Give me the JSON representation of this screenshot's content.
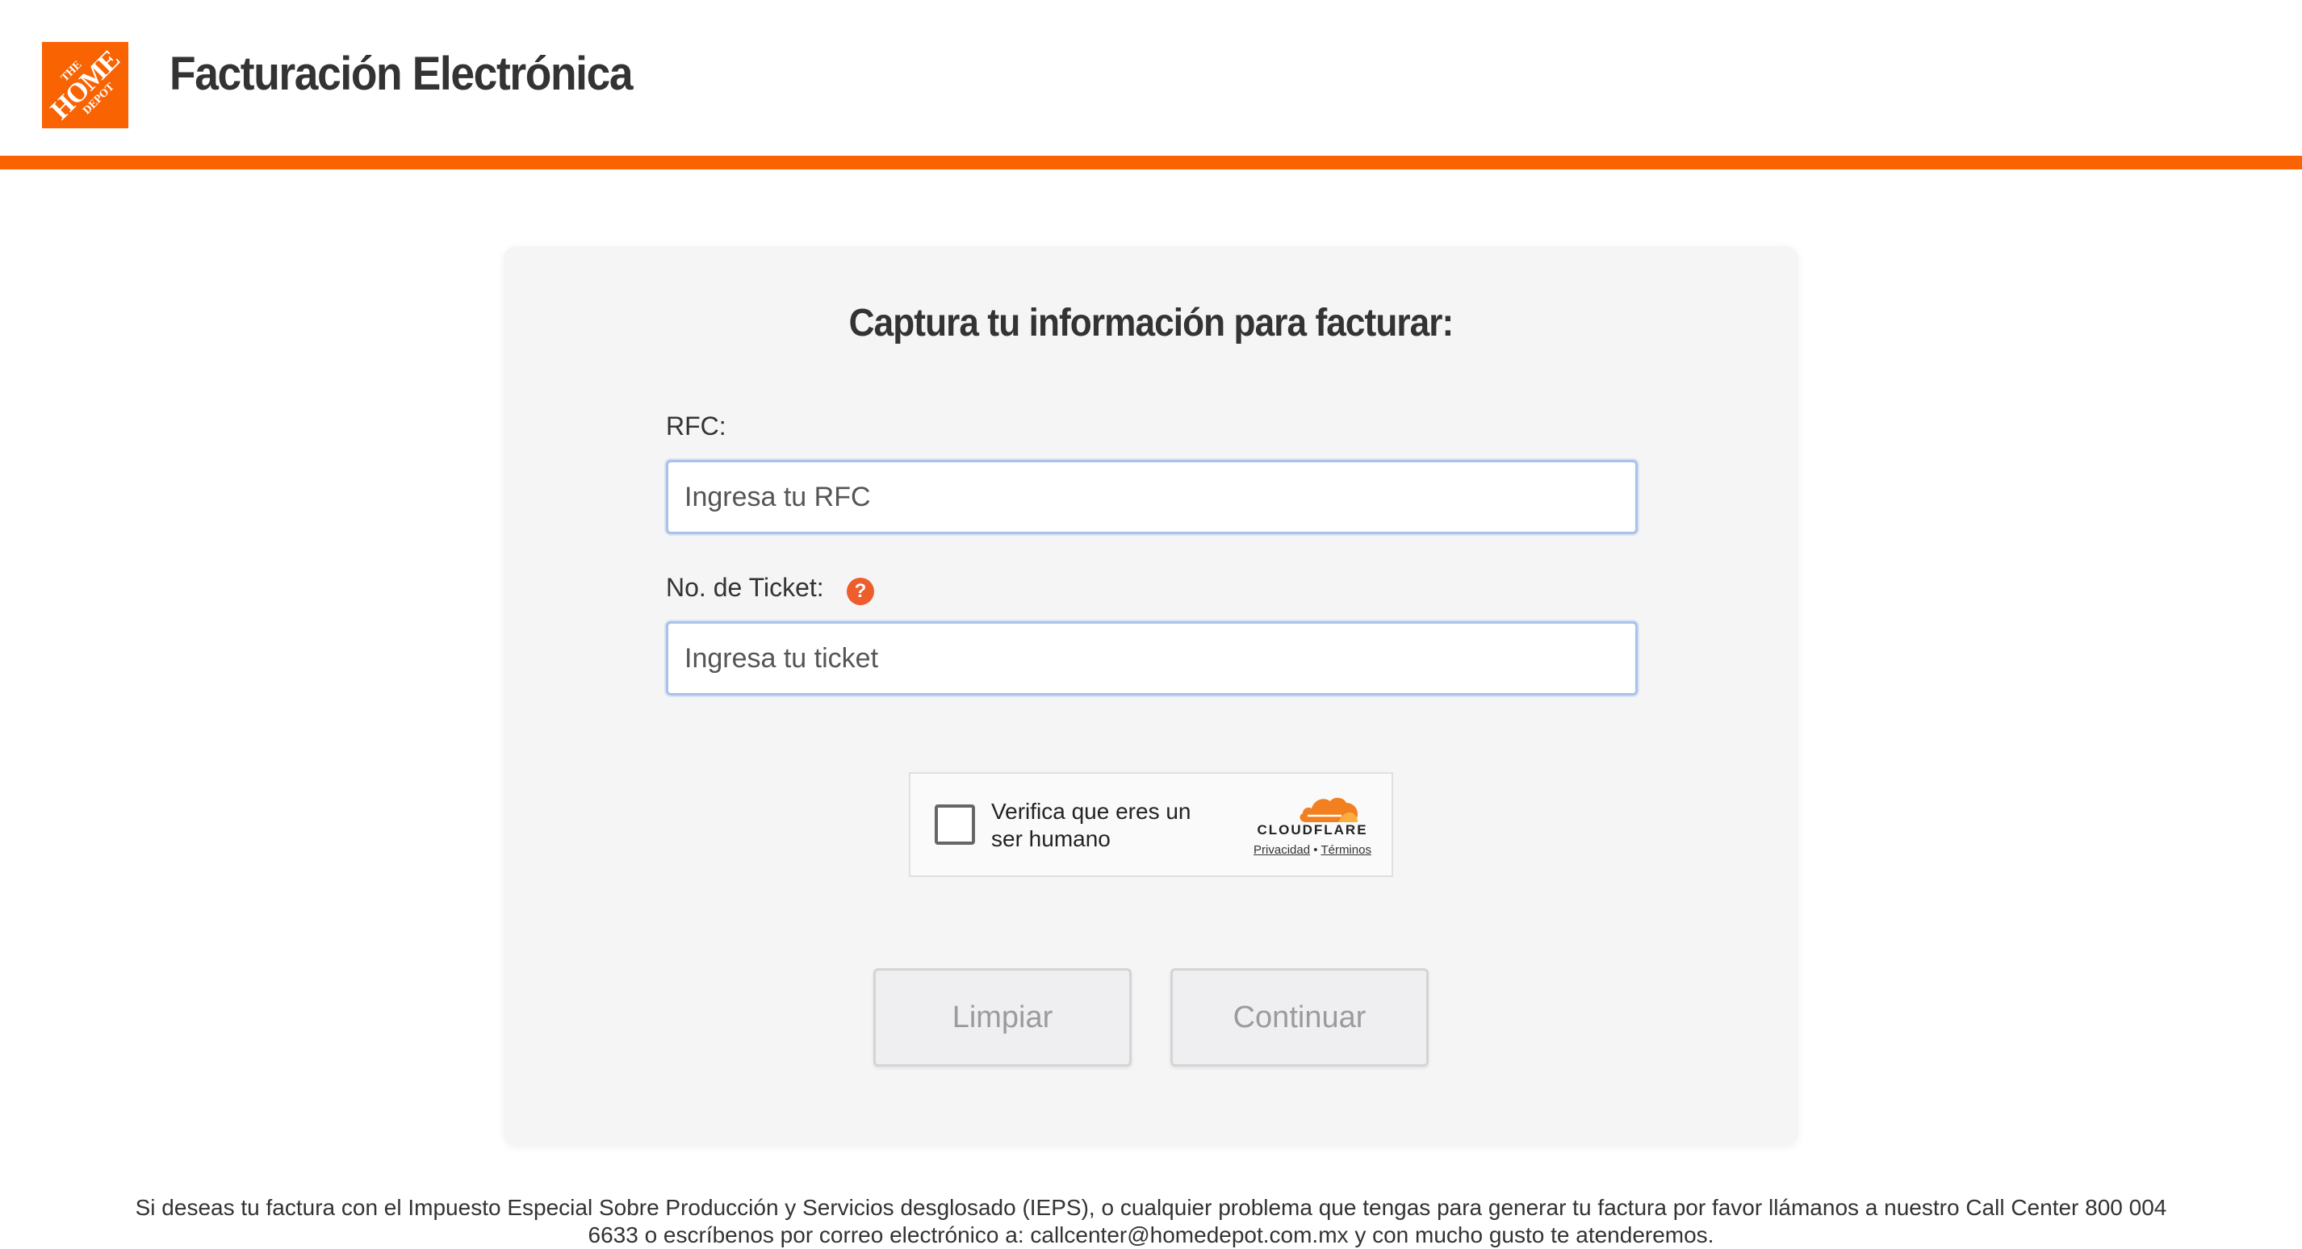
{
  "header": {
    "logo_lines": [
      "THE",
      "HOME",
      "DEPOT"
    ],
    "title": "Facturación Electrónica"
  },
  "form": {
    "title": "Captura tu información para facturar:",
    "rfc": {
      "label": "RFC:",
      "placeholder": "Ingresa tu RFC",
      "value": ""
    },
    "ticket": {
      "label": "No. de Ticket:",
      "help_icon": "question-icon",
      "help_glyph": "?",
      "placeholder": "Ingresa tu ticket",
      "value": ""
    },
    "captcha": {
      "label": "Verifica que eres un ser humano",
      "brand": "CLOUDFLARE",
      "privacy_link": "Privacidad",
      "separator": "•",
      "terms_link": "Términos",
      "checked": false
    },
    "buttons": {
      "clear_label": "Limpiar",
      "continue_label": "Continuar",
      "enabled": false
    }
  },
  "footer": {
    "text": "Si deseas tu factura con el Impuesto Especial Sobre Producción y Servicios desglosado (IEPS), o cualquier problema que tengas para generar tu factura por favor llámanos a nuestro Call Center 800 004 6633 o escríbenos por correo electrónico a: callcenter@homedepot.com.mx y con mucho gusto te atenderemos."
  },
  "colors": {
    "brand_orange": "#f96302",
    "help_icon": "#ee5d2c",
    "card_background": "#f5f5f5",
    "input_border": "#a8c2ea",
    "disabled_text": "#9b9b9b",
    "cloudflare_orange": "#f38020"
  }
}
